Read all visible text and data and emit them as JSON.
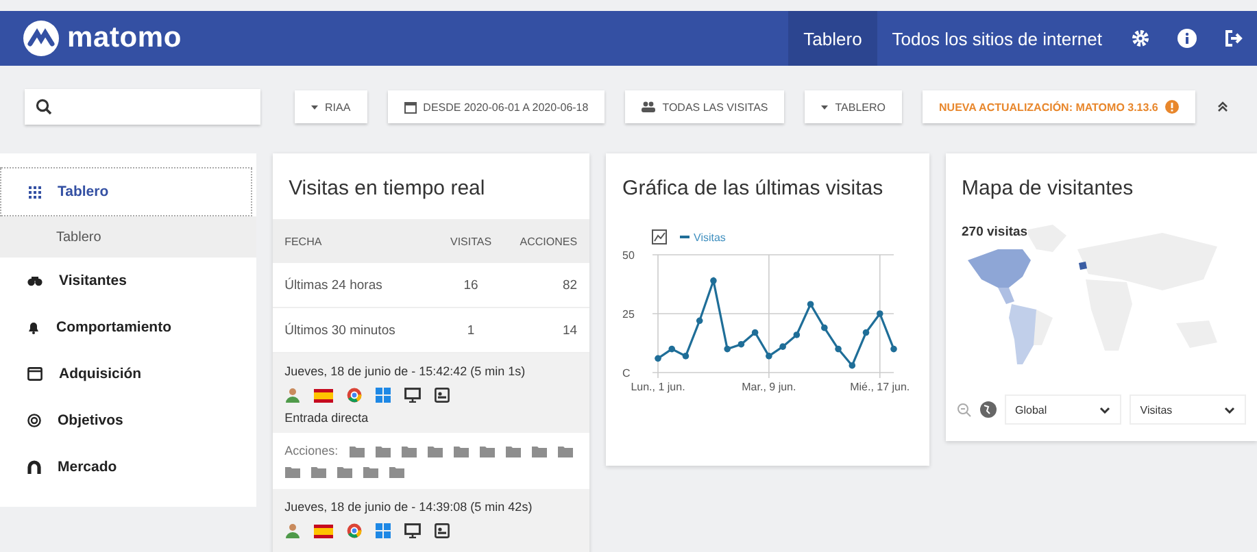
{
  "header": {
    "logo": "matomo",
    "nav": [
      {
        "label": "Tablero",
        "selected": true
      },
      {
        "label": "Todos los sitios de internet",
        "selected": false
      }
    ]
  },
  "toolbar": {
    "buttons": [
      {
        "kind": "caret",
        "label": "RIAA"
      },
      {
        "kind": "calendar",
        "label": "DESDE 2020-06-01 A 2020-06-18"
      },
      {
        "kind": "segment",
        "label": "TODAS LAS VISITAS"
      },
      {
        "kind": "caret",
        "label": "TABLERO"
      },
      {
        "kind": "update",
        "label": "NUEVA ACTUALIZACIÓN: MATOMO 3.13.6"
      }
    ]
  },
  "sidebar": {
    "items": [
      {
        "kind": "grid",
        "label": "Tablero",
        "expanded": true,
        "children": [
          {
            "label": "Tablero",
            "selected": true
          }
        ]
      },
      {
        "kind": "binoculars",
        "label": "Visitantes",
        "expanded": false
      },
      {
        "kind": "bell",
        "label": "Comportamiento",
        "expanded": false
      },
      {
        "kind": "window",
        "label": "Adquisición",
        "expanded": false
      },
      {
        "kind": "target",
        "label": "Objetivos",
        "expanded": false
      },
      {
        "kind": "magnet",
        "label": "Mercado",
        "expanded": false
      }
    ]
  },
  "realtime": {
    "title": "Visitas en tiempo real",
    "columns": [
      "FECHA",
      "VISITAS",
      "ACCIONES"
    ],
    "rows": [
      [
        "Últimas 24 horas",
        "16",
        "82"
      ],
      [
        "Últimos 30 minutos",
        "1",
        "14"
      ]
    ],
    "visits": [
      {
        "time": "Jueves, 18 de junio de - 15:42:42 (5 min 1s)",
        "referrer": "Entrada directa",
        "actions_label": "Acciones:",
        "actions": [
          {
            "kind": "page"
          },
          {
            "kind": "page"
          },
          {
            "kind": "page"
          },
          {
            "kind": "page"
          },
          {
            "kind": "page"
          },
          {
            "kind": "page"
          },
          {
            "kind": "page"
          },
          {
            "kind": "page"
          },
          {
            "kind": "page"
          },
          {
            "kind": "page"
          },
          {
            "kind": "page"
          },
          {
            "kind": "page"
          },
          {
            "kind": "page"
          },
          {
            "kind": "page"
          }
        ]
      },
      {
        "time": "Jueves, 18 de junio de - 14:39:08 (5 min 42s)"
      }
    ]
  },
  "graph": {
    "title": "Gráfica de las últimas visitas",
    "chart_data": {
      "type": "line",
      "categories": [
        "Lun., 1 jun.",
        null,
        null,
        null,
        null,
        null,
        null,
        null,
        "Mar., 9 jun.",
        null,
        null,
        null,
        null,
        null,
        null,
        null,
        "Mié., 17 jun.",
        null
      ],
      "grid": true,
      "series": [
        {
          "name": "Visitas",
          "color": "#1f6e98",
          "marker": "circle",
          "values": [
            6,
            10,
            7,
            22,
            39,
            10,
            12,
            17,
            7,
            11,
            16,
            29,
            19,
            10,
            3,
            17,
            25,
            10
          ]
        }
      ],
      "ylim": [
        0,
        50
      ],
      "yticks": [
        {
          "value": 0,
          "label": "C"
        },
        25,
        50
      ]
    }
  },
  "map": {
    "title": "Mapa de visitantes",
    "total": "270 visitas",
    "selects": [
      "Global",
      "Visitas"
    ]
  }
}
